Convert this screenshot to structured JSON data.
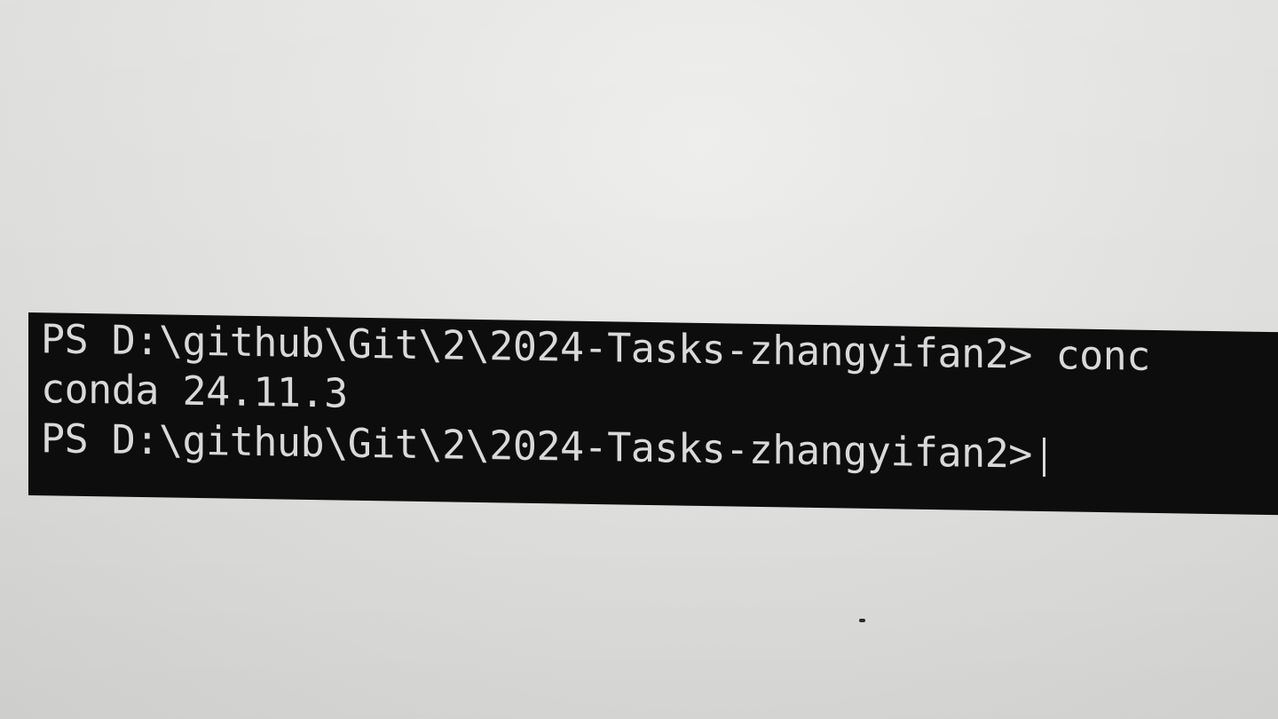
{
  "terminal": {
    "background": "#0d0d0d",
    "foreground": "#d9d9d9",
    "lines": [
      {
        "prompt": "PS D:\\github\\Git\\2\\2024-Tasks-zhangyifan2>",
        "command": "conc"
      },
      {
        "output": "conda 24.11.3"
      },
      {
        "prompt": "PS D:\\github\\Git\\2\\2024-Tasks-zhangyifan2>",
        "command": ""
      }
    ]
  }
}
